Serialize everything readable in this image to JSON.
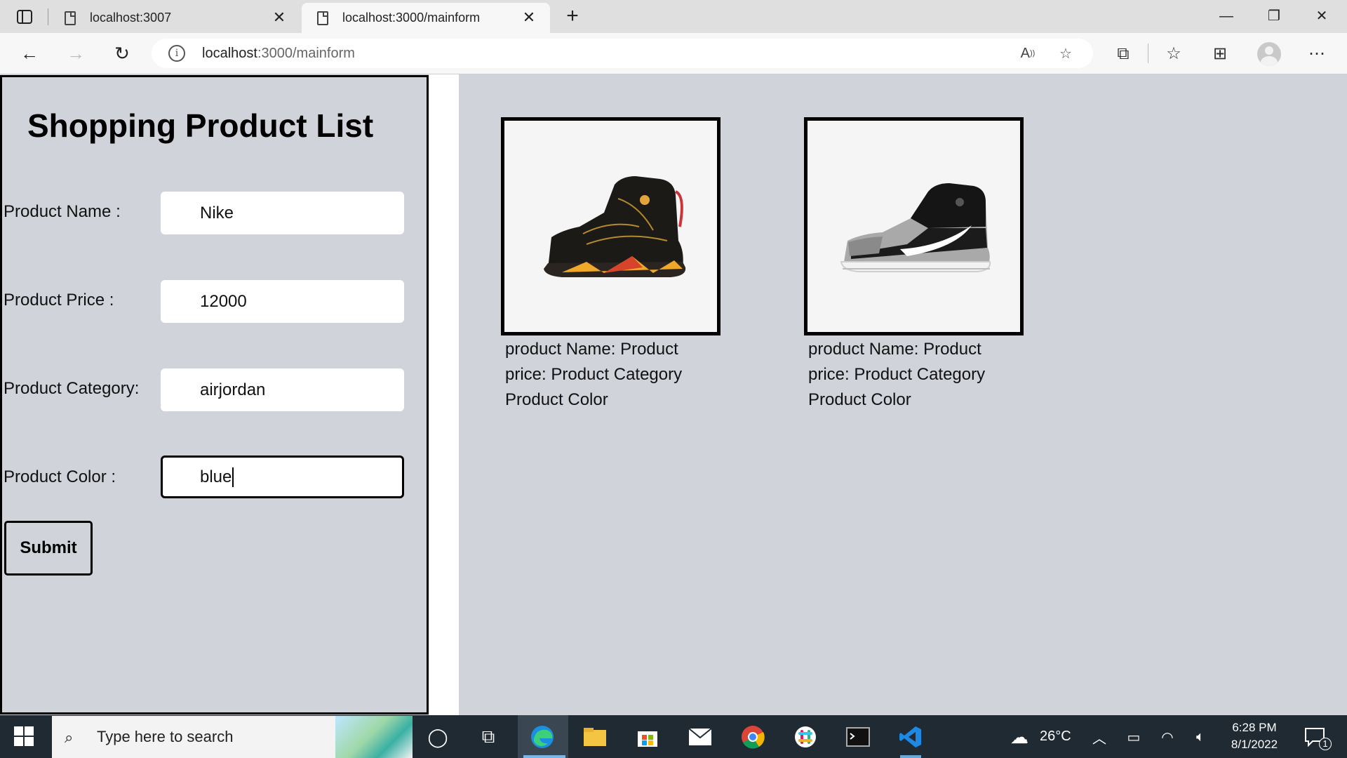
{
  "browser": {
    "tabs": [
      {
        "title": "localhost:3007",
        "active": false
      },
      {
        "title": "localhost:3000/mainform",
        "active": true
      }
    ],
    "url_host": "localhost",
    "url_path": ":3000/mainform"
  },
  "form": {
    "title": "Shopping Product List",
    "fields": [
      {
        "label": "Product Name :",
        "value": "Nike"
      },
      {
        "label": "Product Price :",
        "value": "12000"
      },
      {
        "label": "Product Category:",
        "value": "airjordan"
      },
      {
        "label": "Product Color :",
        "value": "blue"
      }
    ],
    "submit_label": "Submit"
  },
  "products": [
    {
      "image": "black-red-sneaker",
      "caption": "product Name: Product price: Product Category Product Color"
    },
    {
      "image": "grey-black-white-sneaker",
      "caption": "product Name: Product price: Product Category Product Color"
    }
  ],
  "taskbar": {
    "search_placeholder": "Type here to search",
    "weather": "26°C",
    "time": "6:28 PM",
    "date": "8/1/2022",
    "notifications": "1"
  },
  "colors": {
    "page_bg": "#d0d3da",
    "taskbar_bg": "#1f2a33"
  }
}
